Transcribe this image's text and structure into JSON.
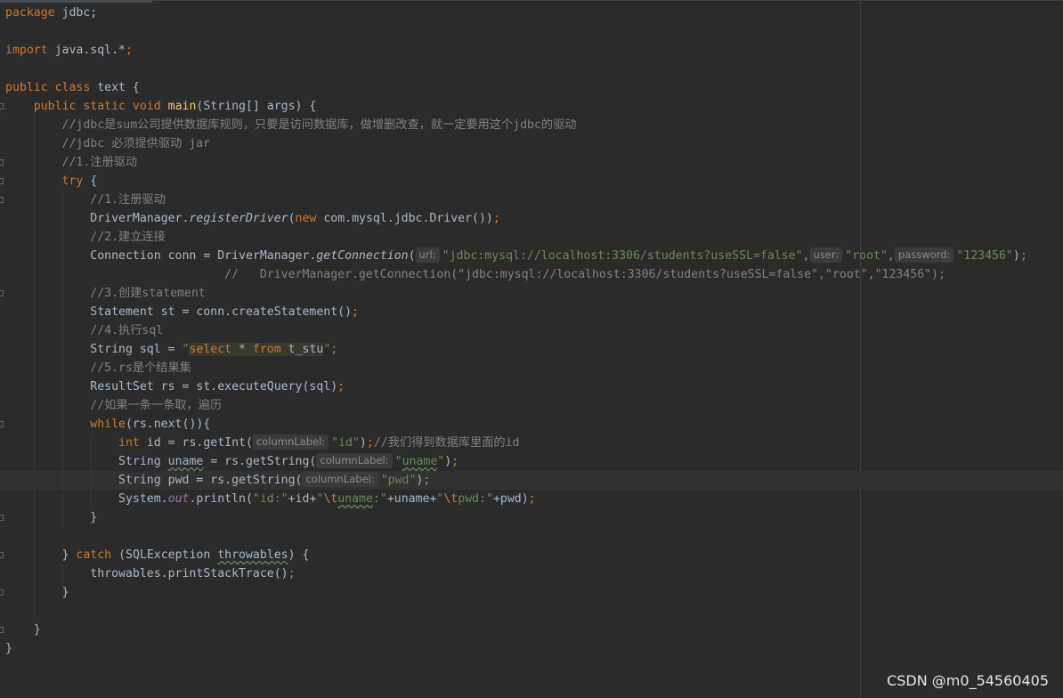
{
  "editor": {
    "l1": {
      "a": "package",
      "b": " jdbc;"
    },
    "l3": {
      "a": "import",
      "b": " java.sql.*",
      "c": ";"
    },
    "l5": {
      "a": "public class",
      "b": " text {"
    },
    "l6": {
      "a": "public static void ",
      "b": "main",
      "c": "(String[] args) {"
    },
    "l7": {
      "a": "//jdbc是sum公司提供数据库规则，只要是访问数据库，做增删改查，就一定要用这个jdbc的驱动"
    },
    "l8": {
      "a": "//jdbc 必须提供驱动 jar"
    },
    "l9": {
      "a": "//1.注册驱动"
    },
    "l10": {
      "a": "try",
      "b": " {"
    },
    "l11": {
      "a": "//1.注册驱动"
    },
    "l12": {
      "a": "DriverManager.",
      "b": "registerDriver",
      "c": "(",
      "d": "new",
      "e": " com.mysql.jdbc.Driver())",
      "f": ";"
    },
    "l13": {
      "a": "//2.建立连接"
    },
    "l14": {
      "a": "Connection conn = DriverManager.",
      "b": "getConnection",
      "c": "(",
      "h1": "url:",
      "s1": "\"jdbc:mysql://localhost:3306/students?useSSL=false\"",
      "k1": ",",
      "h2": "user:",
      "s2": "\"root\"",
      "k2": ",",
      "h3": "password:",
      "s3": "\"123456\"",
      "e": ")",
      "k3": ";"
    },
    "l15": {
      "a": "//   DriverManager.getConnection(\"jdbc:mysql://localhost:3306/students?useSSL=false\",\"root\",\"123456\");"
    },
    "l16": {
      "a": "//3.创建statement"
    },
    "l17": {
      "a": "Statement st = conn.createStatement()",
      "b": ";"
    },
    "l18": {
      "a": "//4.执行sql"
    },
    "l19": {
      "a": "String sql = ",
      "q1": "\"",
      "k1": "select",
      "p1": " * ",
      "k2": "from",
      "p2": " t_stu",
      "q2": "\"",
      "k3": ";"
    },
    "l20": {
      "a": "//5.rs是个结果集"
    },
    "l21": {
      "a": "ResultSet rs = st.executeQuery(sql)",
      "b": ";"
    },
    "l22": {
      "a": "//如果一条一条取，遍历"
    },
    "l23": {
      "a": "while",
      "b": "(rs.next()){"
    },
    "l24": {
      "a": "int",
      "b": " id = rs.getInt(",
      "h": "columnLabel:",
      "s": "\"id\"",
      "c": ")",
      "d": ";",
      "e": "//我们得到数据库里面的id"
    },
    "l25": {
      "a": "String ",
      "b": "uname",
      "c": " = rs.getString(",
      "h": "columnLabel:",
      "s1": "\"",
      "s2": "uname",
      "s3": "\"",
      "d": ")",
      "e": ";"
    },
    "l26": {
      "a": "String pwd = rs.getString(",
      "h": "columnLabel:",
      "s": "\"pwd\"",
      "c": ")",
      "d": ";"
    },
    "l27": {
      "a": "System.",
      "b": "out",
      "c": ".println(",
      "s1": "\"id:\"",
      "p1": "+id+",
      "s2": "\"",
      "e1": "\\t",
      "u1": "uname",
      "s3": ":\"",
      "p2": "+uname+",
      "s4": "\"",
      "e2": "\\t",
      "s5": "pwd:\"",
      "p3": "+pwd)",
      "k": ";"
    },
    "l28": {
      "a": "}"
    },
    "l30": {
      "a": "} ",
      "b": "catch",
      "c": " (SQLException ",
      "d": "throwables",
      "e": ") {"
    },
    "l31": {
      "a": "throwables.printStackTrace()",
      "b": ";"
    },
    "l32": {
      "a": "}"
    },
    "l34": {
      "a": "}"
    },
    "l35": {
      "a": "}"
    }
  },
  "watermark": "CSDN @m0_54560405"
}
